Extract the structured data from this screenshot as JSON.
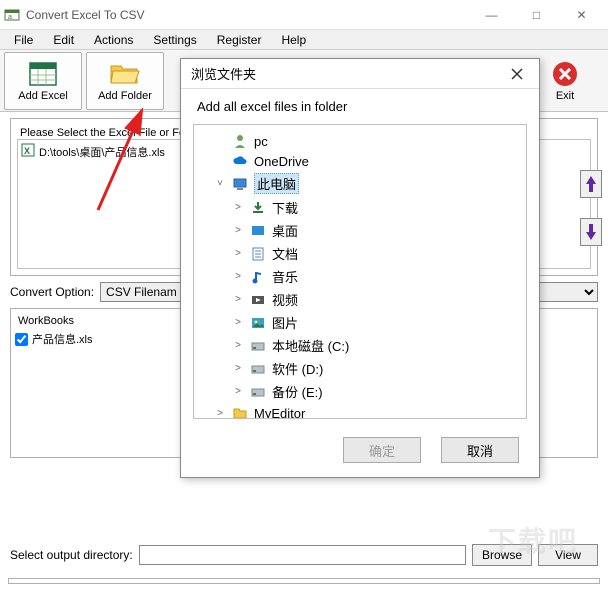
{
  "window": {
    "title": "Convert Excel To CSV",
    "controls": {
      "minimize": "—",
      "maximize": "□",
      "close": "✕"
    }
  },
  "menu": [
    "File",
    "Edit",
    "Actions",
    "Settings",
    "Register",
    "Help"
  ],
  "toolbar": {
    "add_excel": "Add Excel",
    "add_folder": "Add Folder",
    "exit": "Exit"
  },
  "group": {
    "label": "Please Select the Excel File or Fo"
  },
  "filelist": [
    {
      "icon": "excel",
      "path": "D:\\tools\\桌面\\产品信息.xls"
    }
  ],
  "convert": {
    "label": "Convert Option:",
    "value": "CSV Filenam"
  },
  "workbooks": {
    "label": "WorkBooks",
    "items": [
      {
        "checked": true,
        "name": "产品信息.xls"
      }
    ]
  },
  "arrows": {
    "up": "↑",
    "down": "↓"
  },
  "output": {
    "label": "Select  output directory:",
    "browse": "Browse",
    "view": "View",
    "value": ""
  },
  "dialog": {
    "title": "浏览文件夹",
    "desc": "Add all excel files in folder",
    "ok": "确定",
    "cancel": "取消",
    "tree": [
      {
        "level": 1,
        "expander": "",
        "icon": "user",
        "label": "pc"
      },
      {
        "level": 1,
        "expander": "",
        "icon": "cloud",
        "label": "OneDrive"
      },
      {
        "level": 1,
        "expander": "v",
        "icon": "pc",
        "label": "此电脑",
        "selected": true
      },
      {
        "level": 2,
        "expander": ">",
        "icon": "download",
        "label": "下载"
      },
      {
        "level": 2,
        "expander": ">",
        "icon": "desktop",
        "label": "桌面"
      },
      {
        "level": 2,
        "expander": ">",
        "icon": "doc",
        "label": "文档"
      },
      {
        "level": 2,
        "expander": ">",
        "icon": "music",
        "label": "音乐"
      },
      {
        "level": 2,
        "expander": ">",
        "icon": "video",
        "label": "视频"
      },
      {
        "level": 2,
        "expander": ">",
        "icon": "picture",
        "label": "图片"
      },
      {
        "level": 2,
        "expander": ">",
        "icon": "disk",
        "label": "本地磁盘 (C:)"
      },
      {
        "level": 2,
        "expander": ">",
        "icon": "disk",
        "label": "软件 (D:)"
      },
      {
        "level": 2,
        "expander": ">",
        "icon": "disk",
        "label": "备份 (E:)"
      },
      {
        "level": 1,
        "expander": ">",
        "icon": "folder",
        "label": "MyEditor"
      }
    ]
  },
  "watermark": "下载吧",
  "colors": {
    "excel_green": "#217346",
    "folder_yellow": "#f7c94b",
    "exit_red": "#d62f2f",
    "arrow_purple": "#5a2ca0",
    "onedrive_blue": "#0a78d4"
  }
}
